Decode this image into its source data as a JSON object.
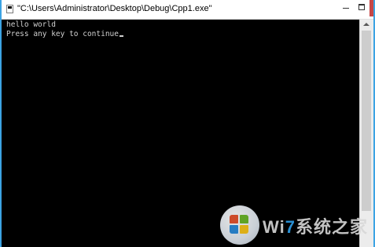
{
  "window": {
    "title": "\"C:\\Users\\Administrator\\Desktop\\Debug\\Cpp1.exe\"",
    "border_color": "#3ca3e3",
    "background": "#000000"
  },
  "titlebar": {
    "icon": "console-app-icon",
    "minimize_icon": "minimize-icon",
    "maximize_icon": "maximize-icon",
    "close_color": "#c74747"
  },
  "console": {
    "lines": [
      "hello world",
      "Press any key to continue"
    ],
    "text_color": "#d0d0d0",
    "cursor": "_"
  },
  "scrollbar": {
    "up_icon": "scroll-up-arrow-icon"
  },
  "watermark": {
    "text_prefix": "Wi",
    "text_seven": "7",
    "text_suffix": "系统之家"
  }
}
